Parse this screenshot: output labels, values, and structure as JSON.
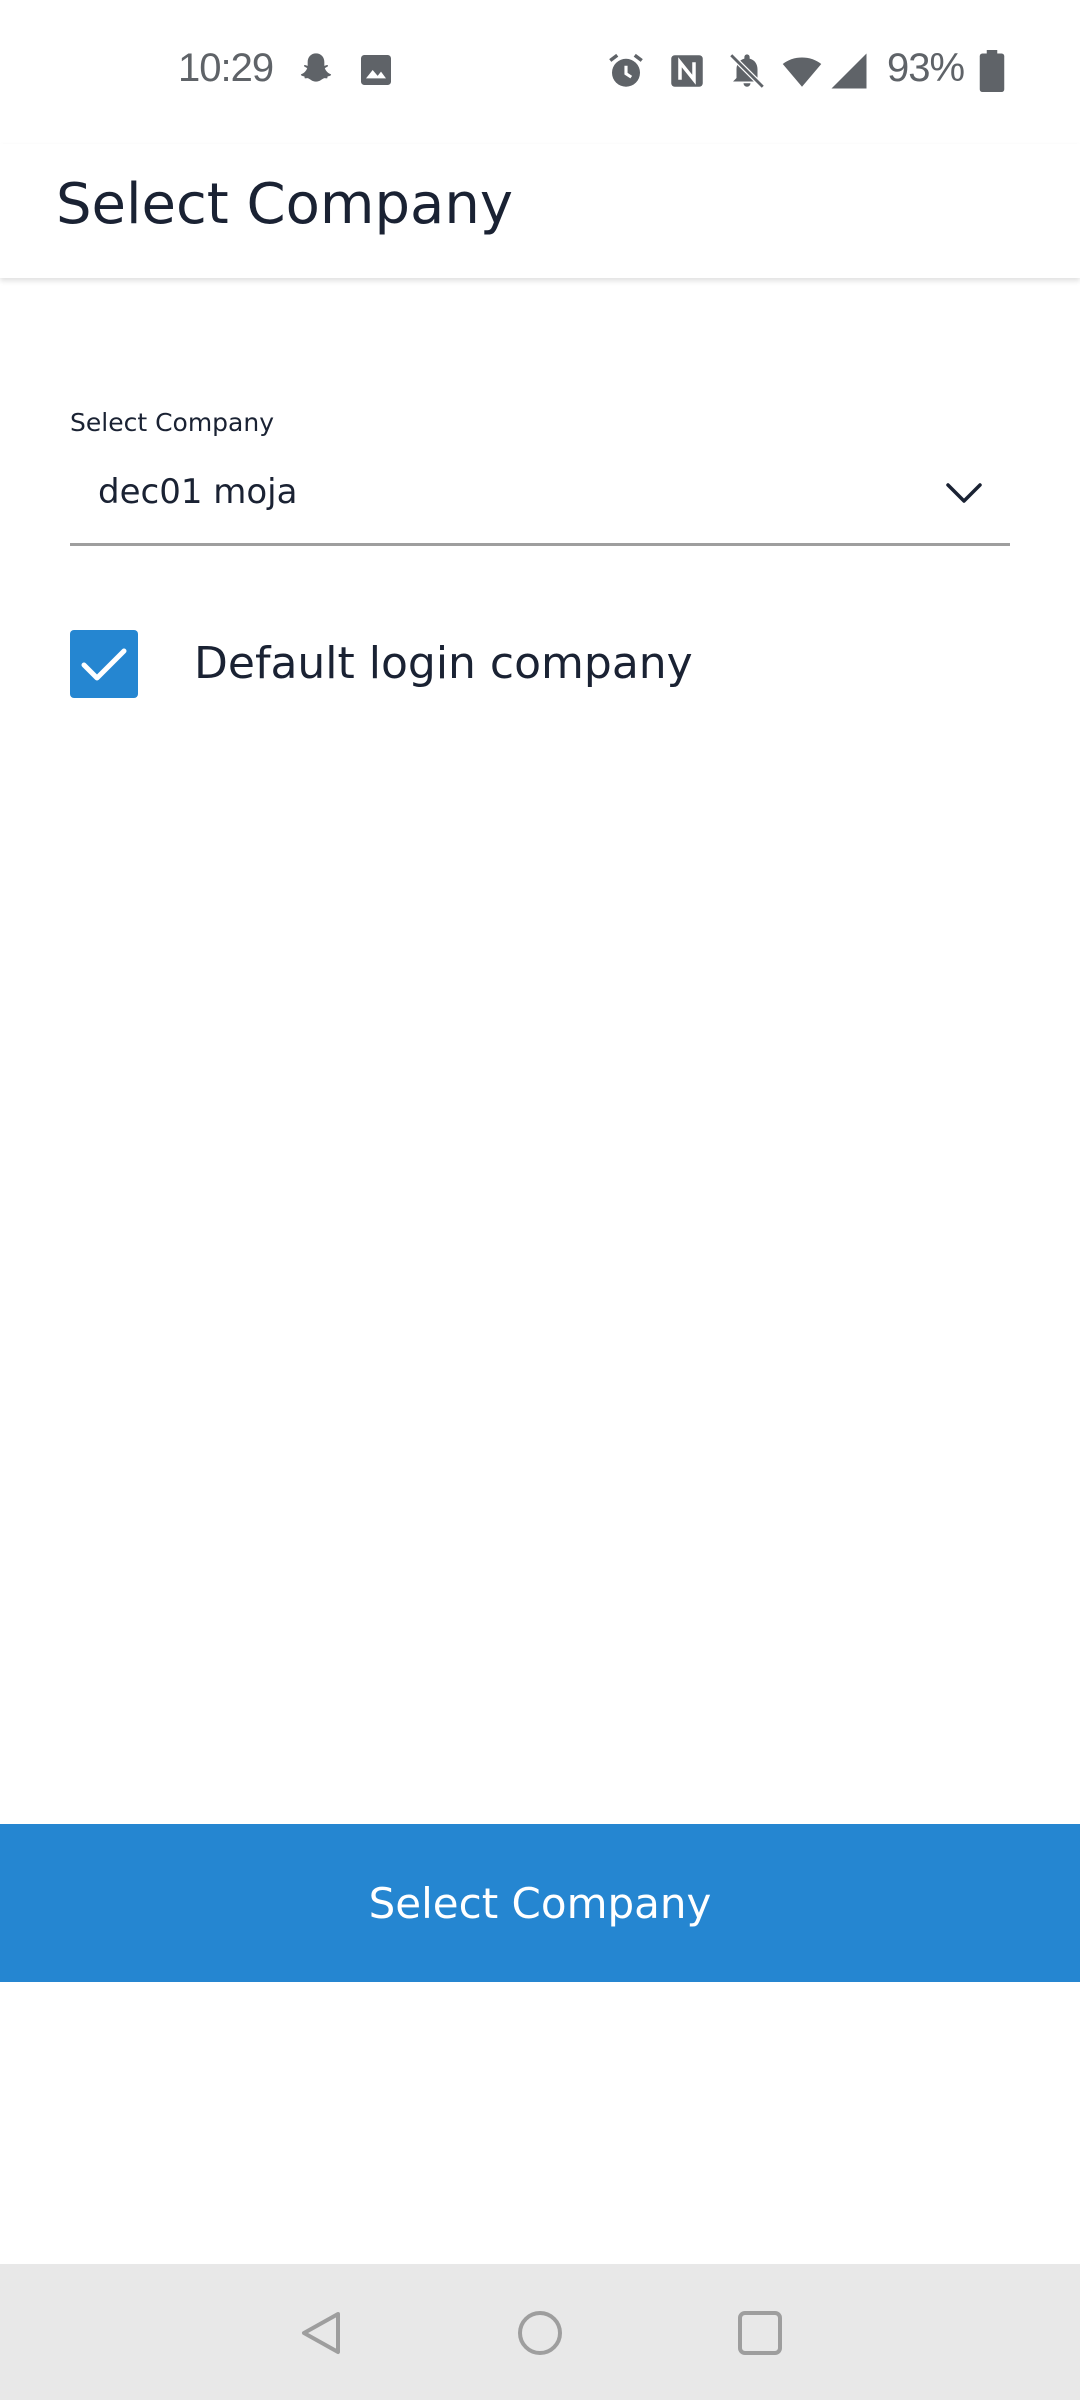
{
  "status_bar": {
    "time": "10:29",
    "battery": "93%",
    "left_icons": [
      "snapchat-icon",
      "image-icon"
    ],
    "right_icons": [
      "alarm-icon",
      "nfc-icon",
      "bell-off-icon",
      "wifi-icon",
      "signal-icon",
      "battery-icon"
    ]
  },
  "app_bar": {
    "title": "Select Company"
  },
  "form": {
    "company_label": "Select Company",
    "company_value": "dec01 moja",
    "default_checkbox_label": "Default login company",
    "default_checked": true
  },
  "actions": {
    "select_button_label": "Select Company"
  },
  "colors": {
    "accent": "#2586d1",
    "text": "#1a2233",
    "nav_bg": "#e8e8e8"
  },
  "nav_bar": {
    "buttons": [
      "back-icon",
      "home-icon",
      "recents-icon"
    ]
  }
}
